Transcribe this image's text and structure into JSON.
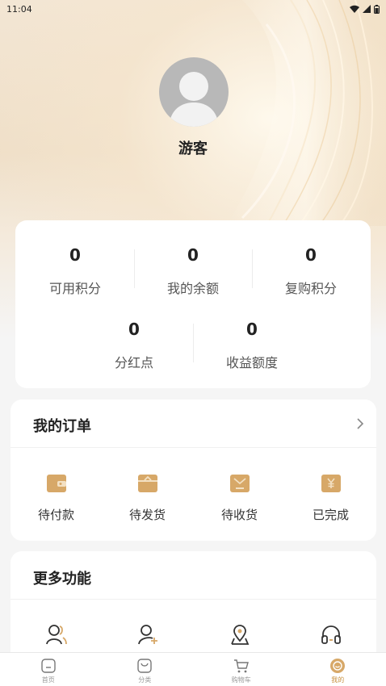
{
  "status_bar": {
    "time": "11:04"
  },
  "profile": {
    "name": "游客"
  },
  "stats": {
    "row1": [
      {
        "value": "0",
        "label": "可用积分"
      },
      {
        "value": "0",
        "label": "我的余额"
      },
      {
        "value": "0",
        "label": "复购积分"
      }
    ],
    "row2": [
      {
        "value": "0",
        "label": "分红点"
      },
      {
        "value": "0",
        "label": "收益额度"
      }
    ]
  },
  "orders": {
    "title": "我的订单",
    "items": [
      {
        "label": "待付款",
        "icon": "wallet-icon"
      },
      {
        "label": "待发货",
        "icon": "package-icon"
      },
      {
        "label": "待收货",
        "icon": "box-icon"
      },
      {
        "label": "已完成",
        "icon": "yen-bag-icon"
      }
    ]
  },
  "more": {
    "title": "更多功能",
    "items": [
      {
        "icon": "team-icon"
      },
      {
        "icon": "add-user-icon"
      },
      {
        "icon": "location-icon"
      },
      {
        "icon": "headset-icon"
      }
    ]
  },
  "tabbar": {
    "items": [
      {
        "label": "首页",
        "icon": "home-icon"
      },
      {
        "label": "分类",
        "icon": "category-icon"
      },
      {
        "label": "购物车",
        "icon": "cart-icon"
      },
      {
        "label": "我的",
        "icon": "profile-icon"
      }
    ],
    "active_index": 3
  },
  "colors": {
    "accent": "#c8913f",
    "icon_gold": "#d7a868",
    "background": "#f5f5f5"
  }
}
